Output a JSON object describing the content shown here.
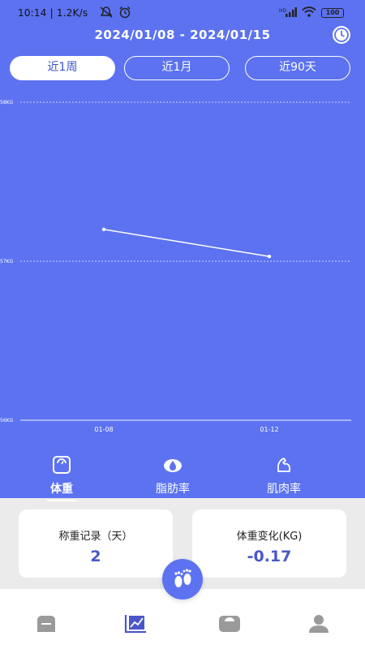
{
  "status": {
    "time": "10:14",
    "speed": "| 1.2K/s",
    "battery": "100"
  },
  "header": {
    "date_range": "2024/01/08 - 2024/01/15"
  },
  "tabs": [
    {
      "label": "近1周",
      "active": true
    },
    {
      "label": "近1月",
      "active": false
    },
    {
      "label": "近90天",
      "active": false
    }
  ],
  "chart_data": {
    "type": "line",
    "x": [
      "01-08",
      "01-12"
    ],
    "series": [
      {
        "values": [
          57.2,
          57.03
        ]
      }
    ],
    "ylim": [
      56,
      58
    ],
    "yticks": [
      "58KG",
      "57KG",
      "56KG"
    ],
    "grid": true,
    "line_color": "#ffffff"
  },
  "metrics": [
    {
      "label": "体重",
      "icon": "scale-icon",
      "active": true
    },
    {
      "label": "脂肪率",
      "icon": "drop-icon",
      "active": false
    },
    {
      "label": "肌肉率",
      "icon": "muscle-icon",
      "active": false
    }
  ],
  "cards": {
    "records_title": "称重记录（天）",
    "records_value": "2",
    "change_title": "体重变化(KG)",
    "change_value": "-0.17"
  },
  "nav": {
    "items": [
      "home-icon",
      "chart-icon",
      "scale-icon",
      "profile-icon"
    ],
    "active_color": "#4a57c8",
    "inactive_color": "#9a9a9a"
  },
  "colors": {
    "primary": "#5c72f0",
    "accent_text": "#4a57c8"
  }
}
